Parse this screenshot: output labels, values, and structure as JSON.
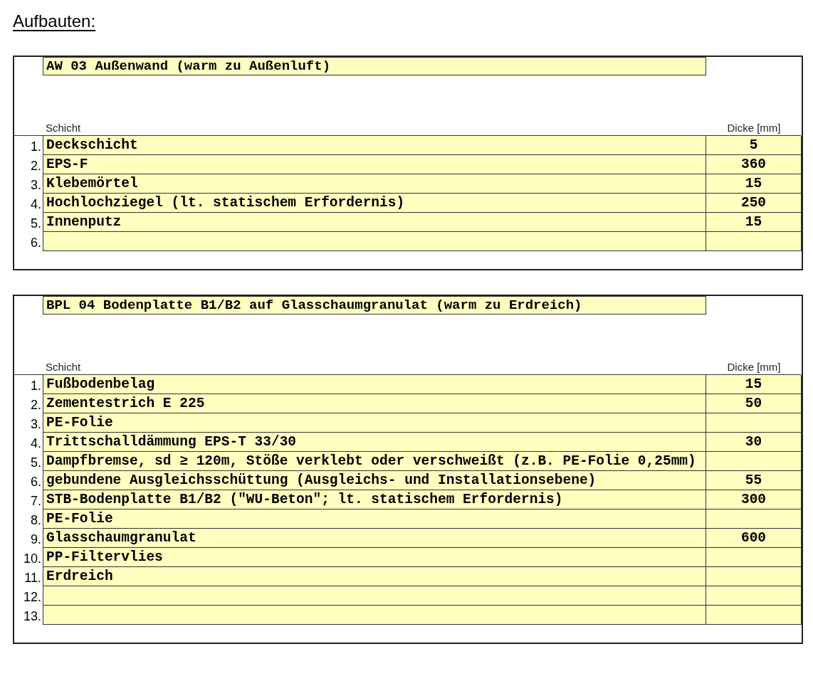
{
  "heading": "Aufbauten:",
  "sections": [
    {
      "title": "AW 03 Außenwand (warm zu Außenluft)",
      "columns": {
        "layer": "Schicht",
        "thickness": "Dicke [mm]"
      },
      "rows": [
        {
          "number": "1.",
          "layer": "Deckschicht",
          "thickness": "5"
        },
        {
          "number": "2.",
          "layer": "EPS-F",
          "thickness": "360"
        },
        {
          "number": "3.",
          "layer": "Klebemörtel",
          "thickness": "15"
        },
        {
          "number": "4.",
          "layer": "Hochlochziegel (lt. statischem Erfordernis)",
          "thickness": "250"
        },
        {
          "number": "5.",
          "layer": "Innenputz",
          "thickness": "15"
        },
        {
          "number": "6."
        }
      ]
    },
    {
      "title": "BPL 04 Bodenplatte B1/B2 auf Glasschaumgranulat (warm zu Erdreich)",
      "columns": {
        "layer": "Schicht",
        "thickness": "Dicke [mm]"
      },
      "rows": [
        {
          "number": "1.",
          "layer": "Fußbodenbelag",
          "thickness": "15"
        },
        {
          "number": "2.",
          "layer": "Zementestrich E 225",
          "thickness": "50"
        },
        {
          "number": "3.",
          "layer": "PE-Folie"
        },
        {
          "number": "4.",
          "layer": "Trittschalldämmung EPS-T 33/30",
          "thickness": "30"
        },
        {
          "number": "5.",
          "layer": "Dampfbremse, sd ≥ 120m, Stöße verklebt oder verschweißt (z.B. PE-Folie 0,25mm)"
        },
        {
          "number": "6.",
          "layer": "gebundene Ausgleichsschüttung (Ausgleichs- und Installationsebene)",
          "thickness": "55"
        },
        {
          "number": "7.",
          "layer": "STB-Bodenplatte B1/B2 (\"WU-Beton\"; lt. statischem Erfordernis)",
          "thickness": "300"
        },
        {
          "number": "8.",
          "layer": "PE-Folie"
        },
        {
          "number": "9.",
          "layer": "Glasschaumgranulat",
          "thickness": "600"
        },
        {
          "number": "10.",
          "layer": "PP-Filtervlies"
        },
        {
          "number": "11.",
          "layer": "Erdreich"
        },
        {
          "number": "12."
        },
        {
          "number": "13."
        }
      ]
    }
  ]
}
